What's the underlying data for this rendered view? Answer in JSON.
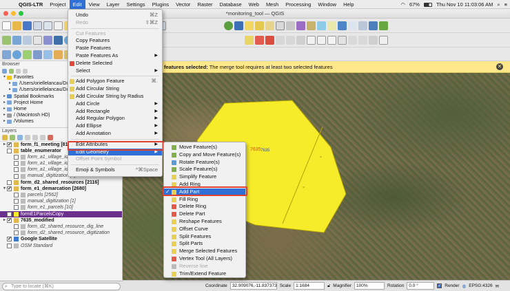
{
  "menubar": {
    "app_name": "QGIS-LTR",
    "items": [
      "Project",
      "Edit",
      "View",
      "Layer",
      "Settings",
      "Plugins",
      "Vector",
      "Raster",
      "Database",
      "Web",
      "Mesh",
      "Processing",
      "Window",
      "Help"
    ],
    "battery": "67%",
    "clock": "Thu Nov 10  11:03:06 AM"
  },
  "window": {
    "title": "*monitoring_tool — QGIS"
  },
  "message_bar": {
    "text_bold": "features selected:",
    "text": " The merge tool requires at least two selected features"
  },
  "edit_menu": {
    "items": [
      {
        "label": "Undo",
        "shortcut": "⌘Z",
        "enabled": true
      },
      {
        "label": "Redo",
        "shortcut": "⇧⌘Z",
        "enabled": false
      },
      {
        "label": "Cut Features",
        "enabled": false
      },
      {
        "label": "Copy Features",
        "enabled": true
      },
      {
        "label": "Paste Features",
        "enabled": true
      },
      {
        "label": "Paste Features As",
        "submenu": true,
        "enabled": true
      },
      {
        "label": "Delete Selected",
        "enabled": true
      },
      {
        "label": "Select",
        "submenu": true,
        "enabled": true
      },
      {
        "label": "Add Polygon Feature",
        "shortcut": "⌘.",
        "enabled": true
      },
      {
        "label": "Add Circular String",
        "enabled": true
      },
      {
        "label": "Add Circular String by Radius",
        "enabled": true
      },
      {
        "label": "Add Circle",
        "submenu": true,
        "enabled": true
      },
      {
        "label": "Add Rectangle",
        "submenu": true,
        "enabled": true
      },
      {
        "label": "Add Regular Polygon",
        "submenu": true,
        "enabled": true
      },
      {
        "label": "Add Ellipse",
        "submenu": true,
        "enabled": true
      },
      {
        "label": "Add Annotation",
        "submenu": true,
        "enabled": true
      },
      {
        "label": "Edit Attributes",
        "submenu": true,
        "enabled": true
      },
      {
        "label": "Edit Geometry",
        "submenu": true,
        "enabled": true,
        "highlighted": true
      },
      {
        "label": "Offset Point Symbol",
        "enabled": false
      },
      {
        "label": "Emoji & Symbols",
        "shortcut": "^⌘Space",
        "enabled": true
      }
    ]
  },
  "geometry_submenu": {
    "items": [
      {
        "label": "Move Feature(s)",
        "enabled": true
      },
      {
        "label": "Copy and Move Feature(s)",
        "enabled": true
      },
      {
        "label": "Rotate Feature(s)",
        "enabled": true
      },
      {
        "label": "Scale Feature(s)",
        "enabled": true
      },
      {
        "label": "Simplify Feature",
        "enabled": true
      },
      {
        "label": "Add Ring",
        "enabled": true
      },
      {
        "label": "Add Part",
        "enabled": true,
        "checked": true,
        "highlighted": true
      },
      {
        "label": "Fill Ring",
        "enabled": true
      },
      {
        "label": "Delete Ring",
        "enabled": true
      },
      {
        "label": "Delete Part",
        "enabled": true
      },
      {
        "label": "Reshape Features",
        "enabled": true
      },
      {
        "label": "Offset Curve",
        "enabled": true
      },
      {
        "label": "Split Features",
        "enabled": true
      },
      {
        "label": "Split Parts",
        "enabled": true
      },
      {
        "label": "Merge Selected Features",
        "enabled": true
      },
      {
        "label": "Vertex Tool (All Layers)",
        "enabled": true
      },
      {
        "label": "Reverse line",
        "enabled": false
      },
      {
        "label": "Trim/Extend Feature",
        "enabled": true
      }
    ]
  },
  "browser": {
    "title": "Browser",
    "items": [
      {
        "label": "Favorites",
        "icon": "star-icon",
        "indent": 0,
        "twisty": "▾"
      },
      {
        "label": "/Users/oriellelancau/Do",
        "icon": "folder-icon",
        "indent": 1,
        "twisty": "▸"
      },
      {
        "label": "/Users/oriellelancau/Do",
        "icon": "folder-icon",
        "indent": 1,
        "twisty": "▸"
      },
      {
        "label": "Spatial Bookmarks",
        "icon": "bookmark-icon",
        "indent": 0,
        "twisty": "▸"
      },
      {
        "label": "Project Home",
        "icon": "folder-icon",
        "indent": 0,
        "twisty": "▸"
      },
      {
        "label": "Home",
        "icon": "folder-icon",
        "indent": 0,
        "twisty": "▸"
      },
      {
        "label": "/ (Macintosh HD)",
        "icon": "drive-icon",
        "indent": 0,
        "twisty": "▸"
      },
      {
        "label": "/Volumes",
        "icon": "folder-icon",
        "indent": 0,
        "twisty": "▸"
      }
    ]
  },
  "layers": {
    "title": "Layers",
    "items": [
      {
        "label": "form_f1_meeting [81]",
        "indent": 0,
        "bold": true,
        "checked": true,
        "twisty": "▸"
      },
      {
        "label": "table_enumerator",
        "indent": 0,
        "bold": true,
        "checked": false,
        "twisty": ""
      },
      {
        "label": "form_a1_village_identi",
        "indent": 1,
        "italic": true,
        "checked": false,
        "twisty": ""
      },
      {
        "label": "form_a1_village_identification [176]",
        "indent": 1,
        "italic": true,
        "checked": false,
        "twisty": ""
      },
      {
        "label": "form_a1_village_identification [0]",
        "indent": 1,
        "italic": true,
        "checked": false,
        "twisty": ""
      },
      {
        "label": "manual_digitization [1]",
        "indent": 1,
        "italic": true,
        "checked": false,
        "twisty": ""
      },
      {
        "label": "form_d2_shared_resources [2116]",
        "indent": 0,
        "bold": true,
        "checked": false,
        "twisty": ""
      },
      {
        "label": "form_e1_demarcation [2680]",
        "indent": 0,
        "bold": true,
        "checked": true,
        "twisty": "▾"
      },
      {
        "label": "parcels [2562]",
        "indent": 1,
        "italic": true,
        "checked": false,
        "twisty": ""
      },
      {
        "label": "manual_digitization [1]",
        "indent": 1,
        "italic": true,
        "checked": false,
        "twisty": ""
      },
      {
        "label": "form_e1_parcels [10]",
        "indent": 1,
        "italic": true,
        "checked": false,
        "twisty": ""
      },
      {
        "label": "formE1ParcelsCopy",
        "indent": 0,
        "bold": false,
        "checked": true,
        "selected": true,
        "twisty": ""
      },
      {
        "label": "7635_modified",
        "indent": 0,
        "bold": true,
        "checked": true,
        "twisty": "▸"
      },
      {
        "label": "form_d2_shared_resource_dig_line",
        "indent": 1,
        "italic": true,
        "checked": false,
        "twisty": ""
      },
      {
        "label": "form_d2_shared_resource_digitization",
        "indent": 1,
        "italic": true,
        "checked": false,
        "twisty": ""
      },
      {
        "label": "Google Satellite",
        "indent": 0,
        "bold": true,
        "checked": true,
        "twisty": ""
      },
      {
        "label": "OSM Standard",
        "indent": 0,
        "italic": true,
        "checked": false,
        "twisty": ""
      }
    ]
  },
  "locator": {
    "placeholder": "Type to locate (⌘K)"
  },
  "statusbar": {
    "coordinate_label": "Coordinate",
    "coordinate_value": "32.909076,-11.837373",
    "scale_label": "Scale",
    "scale_value": "1:1684",
    "magnifier_label": "Magnifier",
    "magnifier_value": "100%",
    "rotation_label": "Rotation",
    "rotation_value": "0.0 °",
    "render_label": "Render",
    "crs_label": "EPSG:4326"
  },
  "map": {
    "feature_label_1": "7635",
    "feature_label_2": "7635",
    "polygon_color": "#f7ec2a"
  }
}
